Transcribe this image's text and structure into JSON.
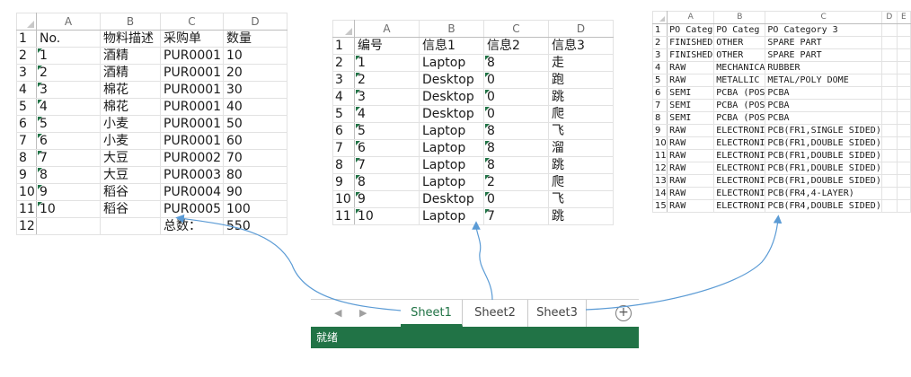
{
  "sheet1": {
    "columns": [
      "A",
      "B",
      "C",
      "D"
    ],
    "rows": [
      {
        "n": "1",
        "a": "No.",
        "b": "物料描述",
        "c": "采购单",
        "d": "数量"
      },
      {
        "n": "2",
        "a": "1",
        "b": "酒精",
        "c": "PUR0001",
        "d": "10"
      },
      {
        "n": "3",
        "a": "2",
        "b": "酒精",
        "c": "PUR0001",
        "d": "20"
      },
      {
        "n": "4",
        "a": "3",
        "b": "棉花",
        "c": "PUR0001",
        "d": "30"
      },
      {
        "n": "5",
        "a": "4",
        "b": "棉花",
        "c": "PUR0001",
        "d": "40"
      },
      {
        "n": "6",
        "a": "5",
        "b": "小麦",
        "c": "PUR0001",
        "d": "50"
      },
      {
        "n": "7",
        "a": "6",
        "b": "小麦",
        "c": "PUR0001",
        "d": "60"
      },
      {
        "n": "8",
        "a": "7",
        "b": "大豆",
        "c": "PUR0002",
        "d": "70"
      },
      {
        "n": "9",
        "a": "8",
        "b": "大豆",
        "c": "PUR0003",
        "d": "80"
      },
      {
        "n": "10",
        "a": "9",
        "b": "稻谷",
        "c": "PUR0004",
        "d": "90"
      },
      {
        "n": "11",
        "a": "10",
        "b": "稻谷",
        "c": "PUR0005",
        "d": "100"
      },
      {
        "n": "12",
        "a": "",
        "b": "",
        "c": "总数：",
        "d": "550"
      }
    ]
  },
  "sheet2": {
    "columns": [
      "A",
      "B",
      "C",
      "D"
    ],
    "rows": [
      {
        "n": "1",
        "a": "编号",
        "b": "信息1",
        "c": "信息2",
        "d": "信息3"
      },
      {
        "n": "2",
        "a": "1",
        "b": "Laptop",
        "c": "8",
        "d": "走"
      },
      {
        "n": "3",
        "a": "2",
        "b": "Desktop",
        "c": "0",
        "d": "跑"
      },
      {
        "n": "4",
        "a": "3",
        "b": "Desktop",
        "c": "0",
        "d": "跳"
      },
      {
        "n": "5",
        "a": "4",
        "b": "Desktop",
        "c": "0",
        "d": "爬"
      },
      {
        "n": "6",
        "a": "5",
        "b": "Laptop",
        "c": "8",
        "d": "飞"
      },
      {
        "n": "7",
        "a": "6",
        "b": "Laptop",
        "c": "8",
        "d": "溜"
      },
      {
        "n": "8",
        "a": "7",
        "b": "Laptop",
        "c": "8",
        "d": "跳"
      },
      {
        "n": "9",
        "a": "8",
        "b": "Laptop",
        "c": "2",
        "d": "爬"
      },
      {
        "n": "10",
        "a": "9",
        "b": "Desktop",
        "c": "0",
        "d": "飞"
      },
      {
        "n": "11",
        "a": "10",
        "b": "Laptop",
        "c": "7",
        "d": "跳"
      }
    ]
  },
  "sheet3": {
    "columns": [
      "A",
      "B",
      "C",
      "D",
      "E"
    ],
    "rows": [
      {
        "n": "1",
        "a": "PO Categ",
        "b": "PO Categ",
        "c": "PO Category 3",
        "d": "",
        "e": ""
      },
      {
        "n": "2",
        "a": "FINISHED",
        "b": "OTHER",
        "c": "SPARE PART",
        "d": "",
        "e": ""
      },
      {
        "n": "3",
        "a": "FINISHED",
        "b": "OTHER",
        "c": "SPARE PART",
        "d": "",
        "e": ""
      },
      {
        "n": "4",
        "a": "RAW",
        "b": "MECHANICA",
        "c": "RUBBER",
        "d": "",
        "e": ""
      },
      {
        "n": "5",
        "a": "RAW",
        "b": "METALLIC",
        "c": "METAL/POLY DOME",
        "d": "",
        "e": ""
      },
      {
        "n": "6",
        "a": "SEMI",
        "b": "PCBA (POS",
        "c": "PCBA",
        "d": "",
        "e": ""
      },
      {
        "n": "7",
        "a": "SEMI",
        "b": "PCBA (POS",
        "c": "PCBA",
        "d": "",
        "e": ""
      },
      {
        "n": "8",
        "a": "SEMI",
        "b": "PCBA (POS",
        "c": "PCBA",
        "d": "",
        "e": ""
      },
      {
        "n": "9",
        "a": "RAW",
        "b": "ELECTRONI",
        "c": "PCB(FR1,SINGLE SIDED)",
        "d": "",
        "e": ""
      },
      {
        "n": "10",
        "a": "RAW",
        "b": "ELECTRONI",
        "c": "PCB(FR1,DOUBLE SIDED)",
        "d": "",
        "e": ""
      },
      {
        "n": "11",
        "a": "RAW",
        "b": "ELECTRONI",
        "c": "PCB(FR1,DOUBLE SIDED)",
        "d": "",
        "e": ""
      },
      {
        "n": "12",
        "a": "RAW",
        "b": "ELECTRONI",
        "c": "PCB(FR1,DOUBLE SIDED)",
        "d": "",
        "e": ""
      },
      {
        "n": "13",
        "a": "RAW",
        "b": "ELECTRONI",
        "c": "PCB(FR1,DOUBLE SIDED)",
        "d": "",
        "e": ""
      },
      {
        "n": "14",
        "a": "RAW",
        "b": "ELECTRONI",
        "c": "PCB(FR4,4-LAYER)",
        "d": "",
        "e": ""
      },
      {
        "n": "15",
        "a": "RAW",
        "b": "ELECTRONI",
        "c": "PCB(FR4,DOUBLE SIDED)",
        "d": "",
        "e": ""
      }
    ]
  },
  "tabs": [
    {
      "label": "Sheet1",
      "active": true
    },
    {
      "label": "Sheet2",
      "active": false
    },
    {
      "label": "Sheet3",
      "active": false
    }
  ],
  "status": {
    "label": "就绪"
  },
  "icons": {
    "prev": "chevron-left-icon",
    "next": "chevron-right-icon",
    "add": "add-sheet-icon"
  },
  "colors": {
    "accent": "#217346",
    "arrow": "#5b9bd5"
  }
}
